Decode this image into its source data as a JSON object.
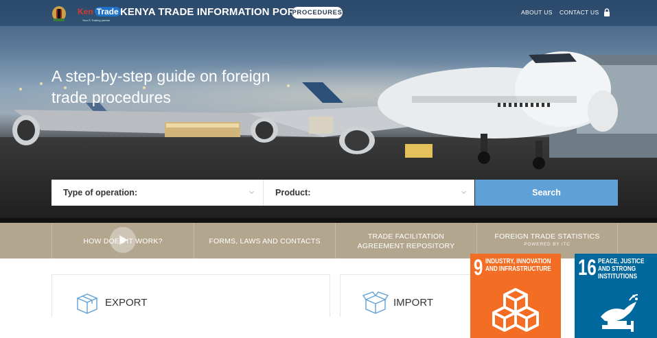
{
  "brand": {
    "logo_text_ken": "Ken",
    "logo_text_trade": "Trade",
    "logo_tagline": "Your E-Trading partner",
    "portal_title": "KENYA TRADE INFORMATION PORTAL",
    "procedures_badge": "PROCEDURES"
  },
  "nav": {
    "about": "ABOUT US",
    "contact": "CONTACT US",
    "lock_icon": "lock-icon"
  },
  "hero": {
    "headline": "A step-by-step guide on foreign trade procedures"
  },
  "search": {
    "operation_label": "Type of operation:",
    "product_label": "Product:",
    "button": "Search"
  },
  "menu": {
    "how": "HOW DOES IT WORK?",
    "forms": "FORMS, LAWS AND CONTACTS",
    "tfa_line1": "TRADE FACILITATION",
    "tfa_line2": "AGREEMENT REPOSITORY",
    "stats_line1": "FOREIGN TRADE STATISTICS",
    "stats_sub": "POWERED BY ITC"
  },
  "cards": {
    "export": "EXPORT",
    "import": "IMPORT"
  },
  "sdg": {
    "goal9": {
      "number": "9",
      "line1": "INDUSTRY, INNOVATION",
      "line2": "AND INFRASTRUCTURE",
      "color": "#f36d25"
    },
    "goal16": {
      "number": "16",
      "line1": "PEACE, JUSTICE",
      "line2": "AND STRONG",
      "line3": "INSTITUTIONS",
      "color": "#00689d"
    }
  },
  "colors": {
    "search_button": "#5fa0d6",
    "menu_band": "#b3a68e"
  }
}
